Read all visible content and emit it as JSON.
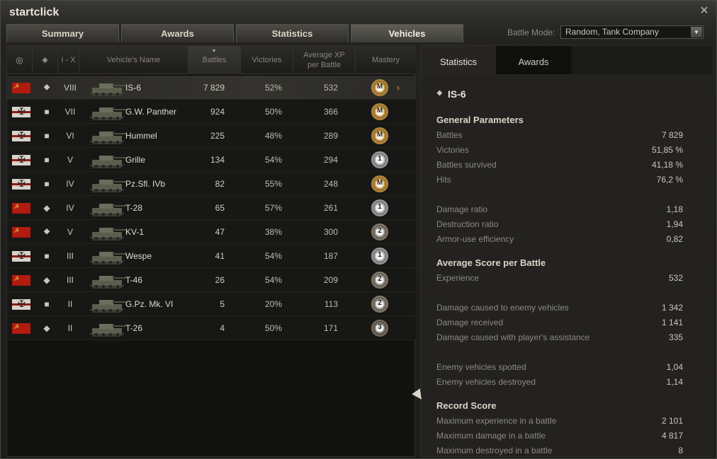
{
  "window": {
    "title": "startclick"
  },
  "tabs": [
    {
      "label": "Summary"
    },
    {
      "label": "Awards"
    },
    {
      "label": "Statistics"
    },
    {
      "label": "Vehicles"
    }
  ],
  "battle_mode": {
    "label": "Battle Mode:",
    "value": "Random, Tank Company"
  },
  "table": {
    "headers": {
      "nation": "",
      "type": "",
      "tier": "I - X",
      "name": "Vehicle's Name",
      "battles": "Battles",
      "victories": "Victories",
      "avgxp": "Average XP per Battle",
      "mastery": "Mastery"
    },
    "rows": [
      {
        "nation": "USSR",
        "type": "heavy",
        "type_glyph": "⯁",
        "tier": "VIII",
        "name": "IS-6",
        "battles": "7 829",
        "victories": "52%",
        "avgxp": "532",
        "mastery": "M",
        "mastery_class": "m"
      },
      {
        "nation": "Germany",
        "type": "spg",
        "type_glyph": "■",
        "tier": "VII",
        "name": "G.W. Panther",
        "battles": "924",
        "victories": "50%",
        "avgxp": "366",
        "mastery": "M",
        "mastery_class": "m"
      },
      {
        "nation": "Germany",
        "type": "spg",
        "type_glyph": "■",
        "tier": "VI",
        "name": "Hummel",
        "battles": "225",
        "victories": "48%",
        "avgxp": "289",
        "mastery": "M",
        "mastery_class": "m"
      },
      {
        "nation": "Germany",
        "type": "spg",
        "type_glyph": "■",
        "tier": "V",
        "name": "Grille",
        "battles": "134",
        "victories": "54%",
        "avgxp": "294",
        "mastery": "1",
        "mastery_class": "n1"
      },
      {
        "nation": "Germany",
        "type": "spg",
        "type_glyph": "■",
        "tier": "IV",
        "name": "Pz.Sfl. IVb",
        "battles": "82",
        "victories": "55%",
        "avgxp": "248",
        "mastery": "M",
        "mastery_class": "m"
      },
      {
        "nation": "USSR",
        "type": "medium",
        "type_glyph": "◆",
        "tier": "IV",
        "name": "T-28",
        "battles": "65",
        "victories": "57%",
        "avgxp": "261",
        "mastery": "1",
        "mastery_class": "n1"
      },
      {
        "nation": "USSR",
        "type": "heavy",
        "type_glyph": "⯁",
        "tier": "V",
        "name": "KV-1",
        "battles": "47",
        "victories": "38%",
        "avgxp": "300",
        "mastery": "2",
        "mastery_class": "n2"
      },
      {
        "nation": "Germany",
        "type": "spg",
        "type_glyph": "■",
        "tier": "III",
        "name": "Wespe",
        "battles": "41",
        "victories": "54%",
        "avgxp": "187",
        "mastery": "1",
        "mastery_class": "n1"
      },
      {
        "nation": "USSR",
        "type": "light",
        "type_glyph": "◆",
        "tier": "III",
        "name": "T-46",
        "battles": "26",
        "victories": "54%",
        "avgxp": "209",
        "mastery": "2",
        "mastery_class": "n2"
      },
      {
        "nation": "Germany",
        "type": "spg",
        "type_glyph": "■",
        "tier": "II",
        "name": "G.Pz. Mk. VI",
        "battles": "5",
        "victories": "20%",
        "avgxp": "113",
        "mastery": "2",
        "mastery_class": "n2"
      },
      {
        "nation": "USSR",
        "type": "light",
        "type_glyph": "◆",
        "tier": "II",
        "name": "T-26",
        "battles": "4",
        "victories": "50%",
        "avgxp": "171",
        "mastery": "3",
        "mastery_class": "n3"
      }
    ]
  },
  "details": {
    "tabs": [
      "Statistics",
      "Awards"
    ],
    "vehicle": "IS-6",
    "sections": {
      "general": {
        "title": "General Parameters",
        "rows": [
          {
            "label": "Battles",
            "value": "7 829"
          },
          {
            "label": "Victories",
            "value": "51,85 %"
          },
          {
            "label": "Battles survived",
            "value": "41,18 %"
          },
          {
            "label": "Hits",
            "value": "76,2 %"
          },
          {
            "label": "Damage ratio",
            "value": "1,18"
          },
          {
            "label": "Destruction ratio",
            "value": "1,94"
          },
          {
            "label": "Armor-use efficiency",
            "value": "0,82"
          }
        ]
      },
      "average": {
        "title": "Average Score per Battle",
        "rows": [
          {
            "label": "Experience",
            "value": "532"
          },
          {
            "label": "Damage caused to enemy vehicles",
            "value": "1 342"
          },
          {
            "label": "Damage received",
            "value": "1 141"
          },
          {
            "label": "Damage caused with player's assistance",
            "value": "335"
          },
          {
            "label": "Enemy vehicles spotted",
            "value": "1,04"
          },
          {
            "label": "Enemy vehicles destroyed",
            "value": "1,14"
          }
        ]
      },
      "record": {
        "title": "Record Score",
        "rows": [
          {
            "label": "Maximum experience in a battle",
            "value": "2 101"
          },
          {
            "label": "Maximum damage in a battle",
            "value": "4 817"
          },
          {
            "label": "Maximum destroyed in a battle",
            "value": "8"
          }
        ]
      }
    }
  }
}
